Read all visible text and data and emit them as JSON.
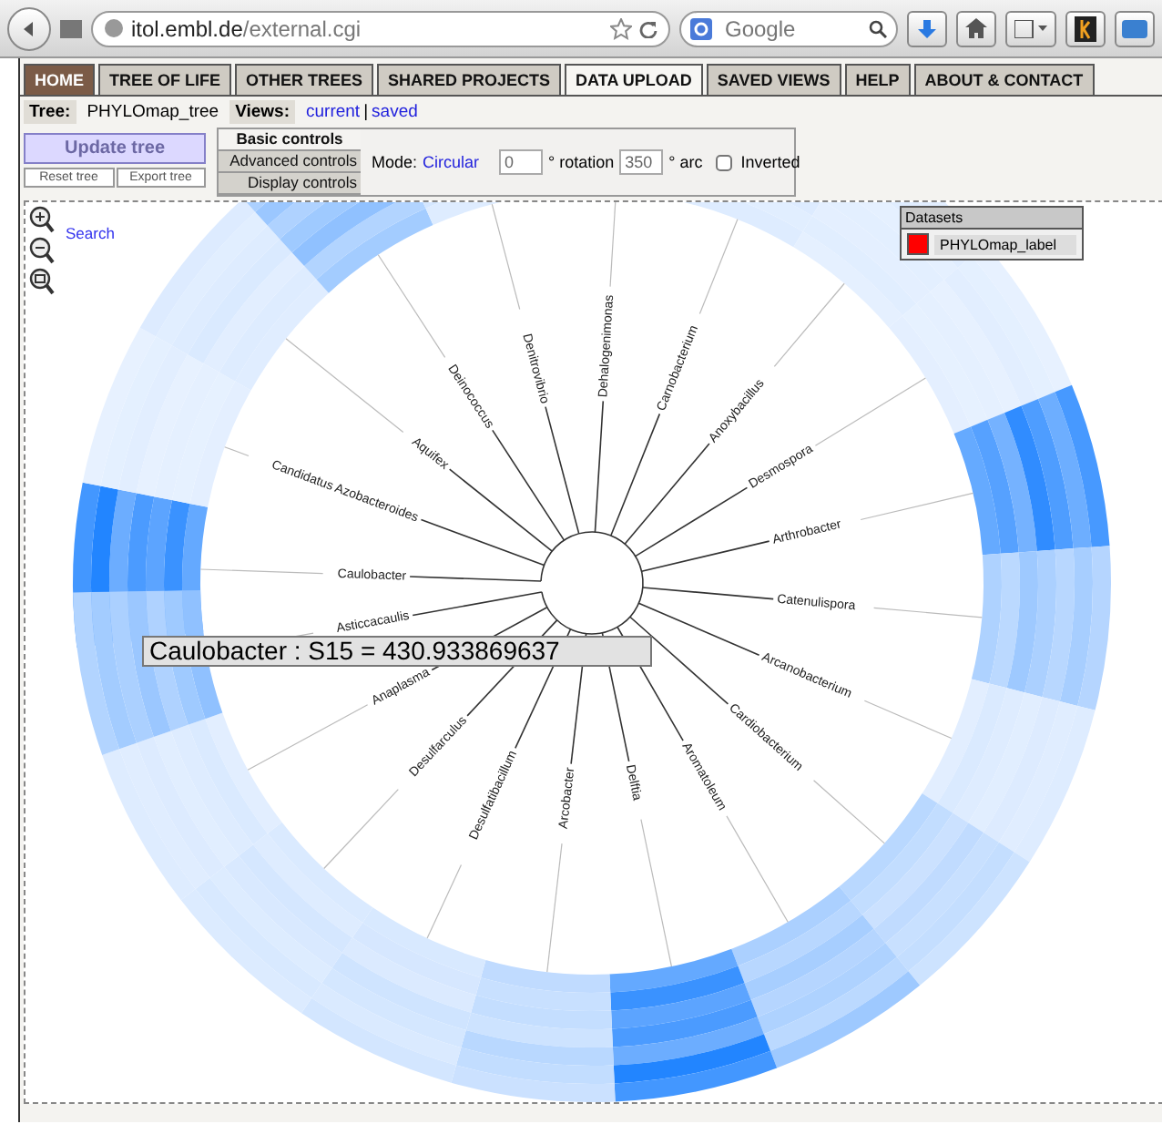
{
  "browser": {
    "url_host": "itol.embl.de",
    "url_path": "/external.cgi",
    "search": {
      "placeholder": "Google"
    }
  },
  "tabs": [
    {
      "label": "HOME",
      "kind": "home",
      "selected": false
    },
    {
      "label": "TREE OF LIFE",
      "kind": "normal",
      "selected": false
    },
    {
      "label": "OTHER TREES",
      "kind": "normal",
      "selected": false
    },
    {
      "label": "SHARED PROJECTS",
      "kind": "normal",
      "selected": false
    },
    {
      "label": "DATA UPLOAD",
      "kind": "normal",
      "selected": true
    },
    {
      "label": "SAVED VIEWS",
      "kind": "normal",
      "selected": false
    },
    {
      "label": "HELP",
      "kind": "normal",
      "selected": false
    },
    {
      "label": "ABOUT & CONTACT",
      "kind": "normal",
      "selected": false
    }
  ],
  "tree_info": {
    "label": "Tree:",
    "name": "PHYLOmap_tree",
    "views_label": "Views:",
    "views": [
      "current",
      "saved"
    ],
    "separator": "|"
  },
  "actions": {
    "update": "Update tree",
    "reset": "Reset tree",
    "export": "Export tree"
  },
  "control_tabs": [
    {
      "label": "Basic controls",
      "selected": true
    },
    {
      "label": "Advanced controls",
      "selected": false
    },
    {
      "label": "Display controls",
      "selected": false
    }
  ],
  "mode": {
    "label": "Mode:",
    "value": "Circular",
    "rotation": "0",
    "rotation_label": "° rotation",
    "arc": "350",
    "arc_label": "° arc",
    "inverted": {
      "label": "Inverted",
      "checked": false
    }
  },
  "canvas": {
    "search": "Search",
    "leaves": [
      "Caulobacter",
      "Candidatus Azobacteroides",
      "Aquifex",
      "Deinococcus",
      "Denitrovibrio",
      "Dehalogenimonas",
      "Carnobacterium",
      "Anoxybacillus",
      "Desmospora",
      "Arthrobacter",
      "Catenulispora",
      "Arcanobacterium",
      "Cardiobacterium",
      "Aromatoleum",
      "Delftia",
      "Arcobacter",
      "Desulfatibacillum",
      "Desulfarculus",
      "Anaplasma",
      "Asticcacaulis"
    ],
    "tooltip": "Caulobacter : S15 = 430.933869637",
    "legend": {
      "title": "Datasets",
      "items": [
        {
          "label": "PHYLOmap_label",
          "color": "#ff0000"
        }
      ]
    }
  }
}
